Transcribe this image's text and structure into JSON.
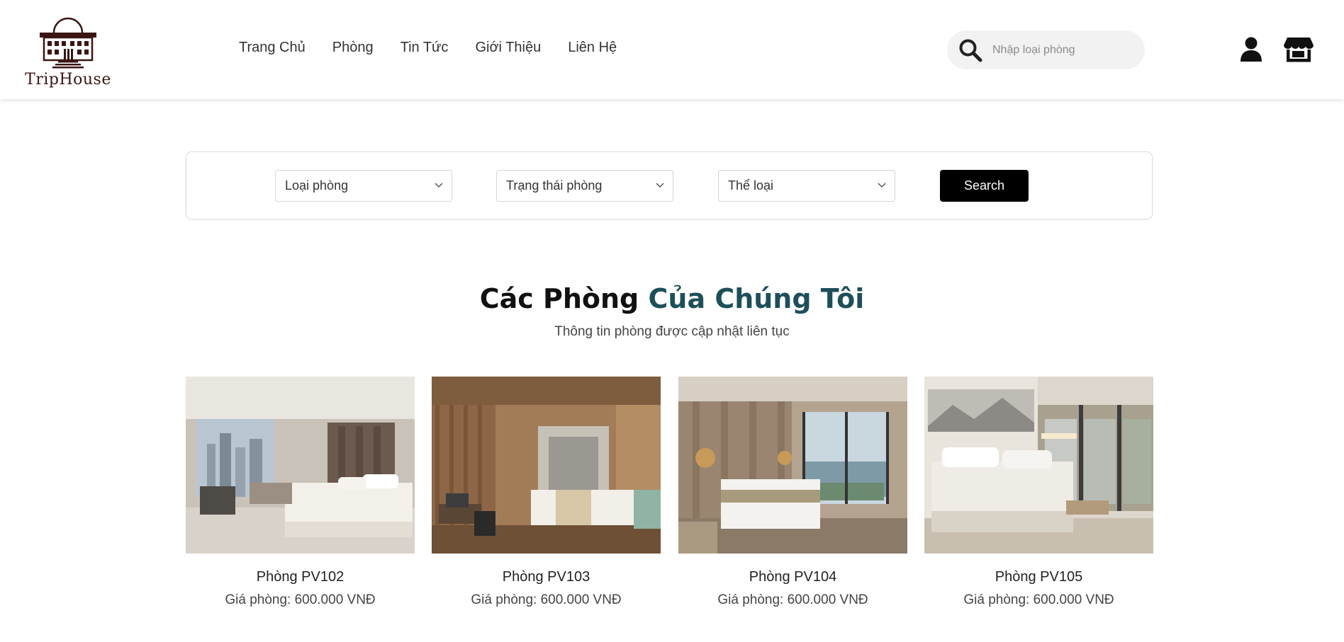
{
  "brand": {
    "name": "TripHouse",
    "color": "#3b1514"
  },
  "nav": {
    "items": [
      "Trang Chủ",
      "Phòng",
      "Tin Tức",
      "Giới Thiệu",
      "Liên Hệ"
    ]
  },
  "search": {
    "placeholder": "Nhập loại phòng",
    "icon": "search-icon"
  },
  "header_icons": {
    "account": "user-icon",
    "store": "store-icon"
  },
  "filters": {
    "room_type": "Loại phòng",
    "room_status": "Trạng thái phòng",
    "category": "Thể loại",
    "search_label": "Search"
  },
  "section": {
    "title_part1": "Các Phòng",
    "title_part2": "Của Chúng Tôi",
    "subtitle": "Thông tin phòng được cập nhật liên tục",
    "accent_color": "#1d4f5a"
  },
  "rooms": [
    {
      "name": "Phòng PV102",
      "price": "Giá phòng: 600.000 VNĐ"
    },
    {
      "name": "Phòng PV103",
      "price": "Giá phòng: 600.000 VNĐ"
    },
    {
      "name": "Phòng PV104",
      "price": "Giá phòng: 600.000 VNĐ"
    },
    {
      "name": "Phòng PV105",
      "price": "Giá phòng: 600.000 VNĐ"
    }
  ]
}
